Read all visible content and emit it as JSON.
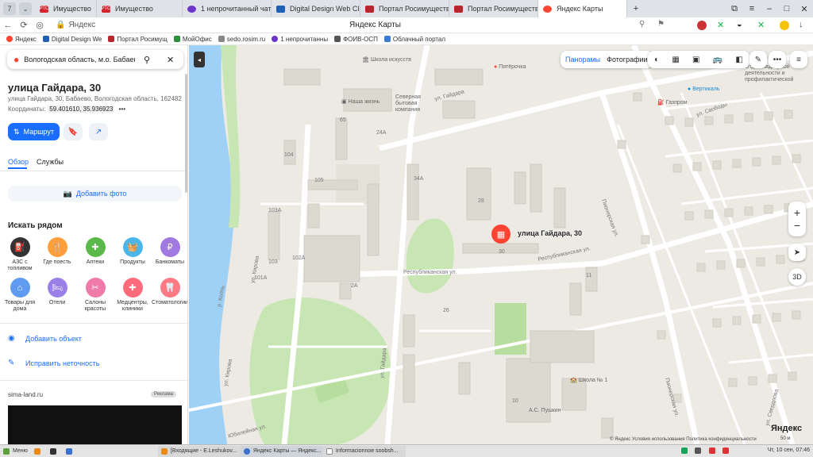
{
  "tabbar": {
    "counter": "7",
    "tabs": [
      {
        "favicon": "РТС",
        "label": "Имущество",
        "color": "#d4262f"
      },
      {
        "favicon": "РТС",
        "label": "Имущество",
        "color": "#d4262f"
      },
      {
        "favicon": "",
        "label": "1 непрочитанный чат",
        "color": "#6b35c8"
      },
      {
        "favicon": "",
        "label": "Digital Design Web Client",
        "color": "#1e5fb7"
      },
      {
        "favicon": "",
        "label": "Портал Росимущества",
        "color": "#b8272d"
      },
      {
        "favicon": "",
        "label": "Портал Росимущества",
        "color": "#b8272d"
      },
      {
        "favicon": "",
        "label": "Яндекс Карты",
        "color": "#f43"
      }
    ],
    "new_tab": "+"
  },
  "addressbar": {
    "url": "Яндекс",
    "page_title": "Яндекс Карты"
  },
  "bookmarks": [
    {
      "label": "Яндекс",
      "color": "#f43"
    },
    {
      "label": "Digital Design We",
      "color": "#1e5fb7"
    },
    {
      "label": "Портал Росимущ",
      "color": "#b8272d"
    },
    {
      "label": "МойОфис",
      "color": "#2d8f3c"
    },
    {
      "label": "sedo.rosim.ru",
      "color": "#888"
    },
    {
      "label": "1 непрочитанны",
      "color": "#6b35c8"
    },
    {
      "label": "ФОИВ-ОСП",
      "color": "#555"
    },
    {
      "label": "Облачный портал",
      "color": "#3a7bd5"
    }
  ],
  "sidebar": {
    "search_value": "Вологодская область, м.о. Бабаевский",
    "title": "улица Гайдара, 30",
    "address": "улица Гайдара, 30, Бабаево, Вологодская область, 162482",
    "coords_label": "Координаты:",
    "coords_value": "59.401610, 35.936923",
    "route_label": "Маршрут",
    "tabs": [
      "Обзор",
      "Службы"
    ],
    "add_photo": "Добавить фото",
    "nearby_title": "Искать рядом",
    "nearby": [
      {
        "label": "АЗС с топливом",
        "color": "#333333",
        "icon": "⛽"
      },
      {
        "label": "Где поесть",
        "color": "#ff9e3d",
        "icon": "🍴"
      },
      {
        "label": "Аптеки",
        "color": "#5bb94b",
        "icon": "✚"
      },
      {
        "label": "Продукты",
        "color": "#4db6e8",
        "icon": "🧺"
      },
      {
        "label": "Банкоматы",
        "color": "#a07ae0",
        "icon": "₽"
      },
      {
        "label": "Товары для дома",
        "color": "#5f9bf0",
        "icon": "⌂"
      },
      {
        "label": "Отели",
        "color": "#9a7fe6",
        "icon": "🛏"
      },
      {
        "label": "Салоны красоты",
        "color": "#f07aa8",
        "icon": "✂"
      },
      {
        "label": "Медцентры, клиники",
        "color": "#ff6b7a",
        "icon": "✚"
      },
      {
        "label": "Стоматологии",
        "color": "#ff7a85",
        "icon": "🦷"
      }
    ],
    "add_object": "Добавить объект",
    "fix_error": "Исправить неточность",
    "ad_site": "sima-land.ru",
    "ad_badge": "Реклама"
  },
  "map": {
    "toolbar": {
      "panoramas": "Панорамы",
      "photos": "Фотографии"
    },
    "pin_label": "улица Гайдара, 30",
    "zoom_in": "+",
    "zoom_out": "−",
    "mode_3d": "3D",
    "logo": "Яндекс",
    "copyright": "© Яндекс   Условия использования   Политика конфиденциальности",
    "scale": "50 м",
    "labels": [
      "Школа искусств",
      "Пятёрочка",
      "Наша жизнь",
      "Северная бытовая компания",
      "ул. Гайдара",
      "Газпром",
      "Вертикаль",
      "ул. Свободы",
      "Республиканская ул.",
      "Школа № 1",
      "А.С. Пушкин",
      "ул. Кирова",
      "р. Колпь",
      "Юбилейная ул.",
      "Пионерская ул.",
      "Отдел надзорной деятельности и профилактической",
      "ул. Свердлова",
      "105",
      "104",
      "103А",
      "103",
      "101А",
      "24А",
      "26",
      "28",
      "30",
      "34А",
      "11",
      "10",
      "23А",
      "65"
    ]
  },
  "taskbar": {
    "menu": "Меню",
    "tasks": [
      "[Входящие - E.Leshukov...",
      "Яндекс Карты — Яндекс...",
      "Informacionnoe soobsh..."
    ],
    "clock": "Чт, 10 сен, 07:46"
  }
}
